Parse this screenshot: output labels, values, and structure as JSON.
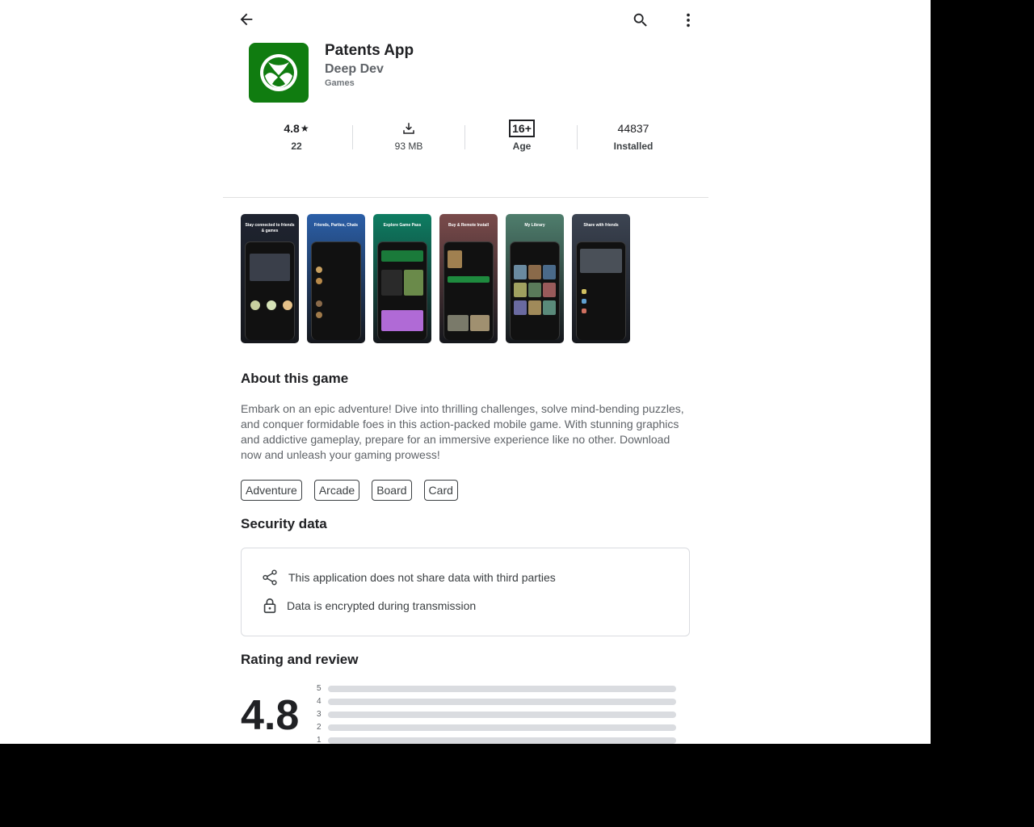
{
  "app": {
    "title": "Patents App",
    "developer": "Deep Dev",
    "category": "Games",
    "icon": "xbox-logo-icon",
    "brand_color": "#107C10"
  },
  "stats": {
    "rating_value": "4.8",
    "rating_count": "22",
    "size": "93 MB",
    "age_badge": "16+",
    "age_label": "Age",
    "installs": "44837",
    "installs_label": "Installed"
  },
  "screenshots": [
    {
      "caption": "Stay connected to friends & games",
      "bg": "#1f2430"
    },
    {
      "caption": "Friends, Parties, Chats",
      "bg": "#2b5fa8"
    },
    {
      "caption": "Explore Game Pass",
      "bg": "#0e7d62"
    },
    {
      "caption": "Buy & Remote Install",
      "bg": "#7a4b4b"
    },
    {
      "caption": "My Library",
      "bg": "#4f7e6d"
    },
    {
      "caption": "Share with friends",
      "bg": "#3c4452"
    }
  ],
  "about": {
    "heading": "About this game",
    "description": "Embark on an epic adventure! Dive into thrilling challenges, solve mind-bending puzzles, and conquer formidable foes in this action-packed mobile game. With stunning graphics and addictive gameplay, prepare for an immersive experience like no other. Download now and unleash your gaming prowess!",
    "tags": [
      "Adventure",
      "Arcade",
      "Board",
      "Card"
    ]
  },
  "security": {
    "heading": "Security data",
    "items": [
      {
        "icon": "share-icon",
        "text": "This application does not share data with third parties"
      },
      {
        "icon": "lock-icon",
        "text": "Data is encrypted during transmission"
      }
    ]
  },
  "ratings": {
    "heading": "Rating and review",
    "average": "4.8",
    "bars": [
      {
        "stars": "5",
        "fraction": 0
      },
      {
        "stars": "4",
        "fraction": 0
      },
      {
        "stars": "3",
        "fraction": 0
      },
      {
        "stars": "2",
        "fraction": 0
      },
      {
        "stars": "1",
        "fraction": 0
      }
    ]
  }
}
